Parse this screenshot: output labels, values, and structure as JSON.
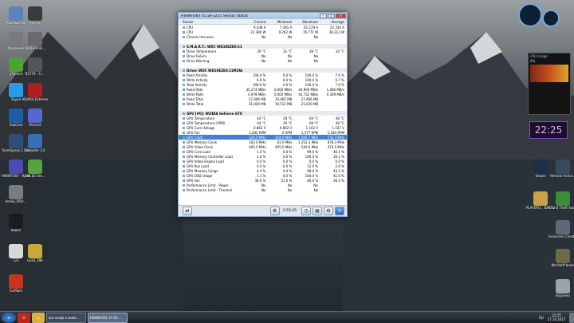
{
  "desktop_icons_left": [
    {
      "label": "Компьютер",
      "color": "#5d84b8"
    },
    {
      "label": "Удаления",
      "color": "#7a7a7a"
    },
    {
      "label": "µTorrent",
      "color": "#4aa42f"
    },
    {
      "label": "Skype",
      "color": "#2a9ce6"
    },
    {
      "label": "SopCast",
      "color": "#1b5ea6"
    },
    {
      "label": "TeamSpeak 3 Client",
      "color": "#2f4d7a"
    },
    {
      "label": "HWiNFO64 - Ярлык",
      "color": "#4b4bb0"
    },
    {
      "label": "Kerwe_Winl...",
      "color": "#7c7c7c"
    },
    {
      "label": "видео",
      "color": "#1c1c1c"
    },
    {
      "label": "123",
      "color": "#d8d8d8"
    },
    {
      "label": "FurMark",
      "color": "#c8341e"
    }
  ],
  "desktop_icons_left2": [
    {
      "label": "Герусс",
      "color": "#3b3b3b"
    },
    {
      "label": "486183692...",
      "color": "#6a6a6a"
    },
    {
      "label": "R5770 - 1-...",
      "color": "#555"
    },
    {
      "label": "AIDA64 Extreme",
      "color": "#b01f1f"
    },
    {
      "label": "Discord",
      "color": "#5767d0"
    },
    {
      "label": "Reloader 3.0",
      "color": "#3b6fb3"
    },
    {
      "label": "398.82 des...",
      "color": "#58a33b"
    },
    {
      "label": "build_398",
      "color": "#c8a93a"
    }
  ],
  "desktop_icons_right": [
    {
      "label": "Steam",
      "color": "#1c2e4a"
    },
    {
      "label": "Remote Activi...",
      "color": "#3a4a5a"
    },
    {
      "label": "PLAYERU... BATTLEGR...",
      "color": "#c8a246"
    },
    {
      "label": "Grand Theft Auto V",
      "color": "#3c8c3c"
    },
    {
      "label": "Assassins Creed Unity",
      "color": "#5a6a7a"
    },
    {
      "label": "Worldoff tanks",
      "color": "#6b6b4a"
    },
    {
      "label": "Корзина",
      "color": "#9aa4ad"
    }
  ],
  "window": {
    "title": "HWiNFO64 v5.58-3255 Sensor Status",
    "columns": [
      "Sensor",
      "Current",
      "Minimum",
      "Maximum",
      "Average"
    ],
    "rows": [
      {
        "t": "r",
        "n": "CPU",
        "v": [
          "9.438 A",
          "7.391 A",
          "61.129 A",
          "22.334 A"
        ]
      },
      {
        "t": "r",
        "n": "CPU",
        "v": [
          "22.390 W",
          "9.262 W",
          "76.771 W",
          "28.312 W"
        ]
      },
      {
        "t": "r",
        "n": "Chassis Intrusion",
        "v": [
          "No",
          "No",
          "No",
          ""
        ]
      },
      {
        "t": "b"
      },
      {
        "t": "g",
        "n": "S.M.A.R.T.: WDC WD10EZEX-21..."
      },
      {
        "t": "r",
        "n": "Drive Temperature",
        "v": [
          "39 °C",
          "31 °C",
          "39 °C",
          "34 °C"
        ]
      },
      {
        "t": "r",
        "n": "Drive Failure",
        "v": [
          "No",
          "No",
          "No",
          ""
        ]
      },
      {
        "t": "r",
        "n": "Drive Warning",
        "v": [
          "No",
          "No",
          "No",
          ""
        ]
      },
      {
        "t": "b"
      },
      {
        "t": "g",
        "n": "Drive: WDC WD10EZEX-21M2NA..."
      },
      {
        "t": "r",
        "n": "Read Activity",
        "v": [
          "100.0 %",
          "0.0 %",
          "100.0 %",
          "7.6 %"
        ]
      },
      {
        "t": "r",
        "n": "Write Activity",
        "v": [
          "6.9 %",
          "0.0 %",
          "100.0 %",
          "0.7 %"
        ]
      },
      {
        "t": "r",
        "n": "Total Activity",
        "v": [
          "100.0 %",
          "0.0 %",
          "100.0 %",
          "7.9 %"
        ]
      },
      {
        "t": "r",
        "n": "Read Rate",
        "v": [
          "45.274 MB/s",
          "0.000 MB/s",
          "44.900 MB/s",
          "1.466 MB/s"
        ]
      },
      {
        "t": "r",
        "n": "Write Rate",
        "v": [
          "0.978 MB/s",
          "0.000 MB/s",
          "44.732 MB/s",
          "0.309 MB/s"
        ]
      },
      {
        "t": "r",
        "n": "Read Total",
        "v": [
          "27,406 MB",
          "10,465 MB",
          "27,406 MB",
          ""
        ]
      },
      {
        "t": "r",
        "n": "Write Total",
        "v": [
          "21,020 MB",
          "19,512 MB",
          "21,020 MB",
          ""
        ]
      },
      {
        "t": "b"
      },
      {
        "t": "g",
        "n": "GPU [#0]: NVIDIA GeForce GTX ..."
      },
      {
        "t": "r",
        "n": "GPU Temperature",
        "v": [
          "44 °C",
          "29 °C",
          "69 °C",
          "46 °C"
        ]
      },
      {
        "t": "r",
        "n": "GPU Temperature (VRM)",
        "v": [
          "44 °C",
          "29 °C",
          "69 °C",
          "48 °C"
        ]
      },
      {
        "t": "r",
        "n": "GPU Core Voltage",
        "v": [
          "0.862 V",
          "0.862 V",
          "1.162 V",
          "1.037 V"
        ]
      },
      {
        "t": "r",
        "n": "GPU Fan",
        "v": [
          "1,282 RPM",
          "0 RPM",
          "1,577 RPM",
          "1,184 RPM"
        ]
      },
      {
        "t": "s",
        "n": "GPU Clock",
        "v": [
          "324.0 MHz",
          "324.0 MHz",
          "1,595.7 MHz",
          "735.3 MHz"
        ]
      },
      {
        "t": "r",
        "n": "GPU Memory Clock",
        "v": [
          "162.0 MHz",
          "81.0 MHz",
          "1,252.3 MHz",
          "878.3 MHz"
        ]
      },
      {
        "t": "r",
        "n": "GPU Video Clock",
        "v": [
          "405.0 MHz",
          "405.0 MHz",
          "540.0 MHz",
          "474.5 MHz"
        ]
      },
      {
        "t": "r",
        "n": "GPU Core Load",
        "v": [
          "1.0 %",
          "0.0 %",
          "99.0 %",
          "40.1 %"
        ]
      },
      {
        "t": "r",
        "n": "GPU Memory Controller Load",
        "v": [
          "1.0 %",
          "0.0 %",
          "100.0 %",
          "16.1 %"
        ]
      },
      {
        "t": "r",
        "n": "GPU Video Engine Load",
        "v": [
          "0.0 %",
          "0.0 %",
          "0.0 %",
          "0.0 %"
        ]
      },
      {
        "t": "r",
        "n": "GPU Bus Load",
        "v": [
          "0.0 %",
          "0.0 %",
          "12.0 %",
          "2.6 %"
        ]
      },
      {
        "t": "r",
        "n": "GPU Memory Usage",
        "v": [
          "4.4 %",
          "4.4 %",
          "98.0 %",
          "43.1 %"
        ]
      },
      {
        "t": "r",
        "n": "GPU D3D Usage",
        "v": [
          "1.1 %",
          "0.0 %",
          "100.0 %",
          "41.0 %"
        ]
      },
      {
        "t": "r",
        "n": "GPU Fan",
        "v": [
          "36.0 %",
          "31.0 %",
          "46.0 %",
          "36.4 %"
        ]
      },
      {
        "t": "r",
        "n": "Performance Limit - Power",
        "v": [
          "No",
          "No",
          "Yes",
          ""
        ]
      },
      {
        "t": "r",
        "n": "Performance Limit - Thermal",
        "v": [
          "No",
          "No",
          "No",
          ""
        ]
      }
    ],
    "footer_time": "1:53:45"
  },
  "gadgets": {
    "clock": "22:25",
    "cpu_title": "CPU Usage",
    "cpu_pct": "2%"
  },
  "taskbar": {
    "items": [
      "все инфа о мойе...",
      "HWiNFO64 v5.58..."
    ],
    "time": "22:25",
    "date": "17.10.2017",
    "lang": "RU"
  }
}
